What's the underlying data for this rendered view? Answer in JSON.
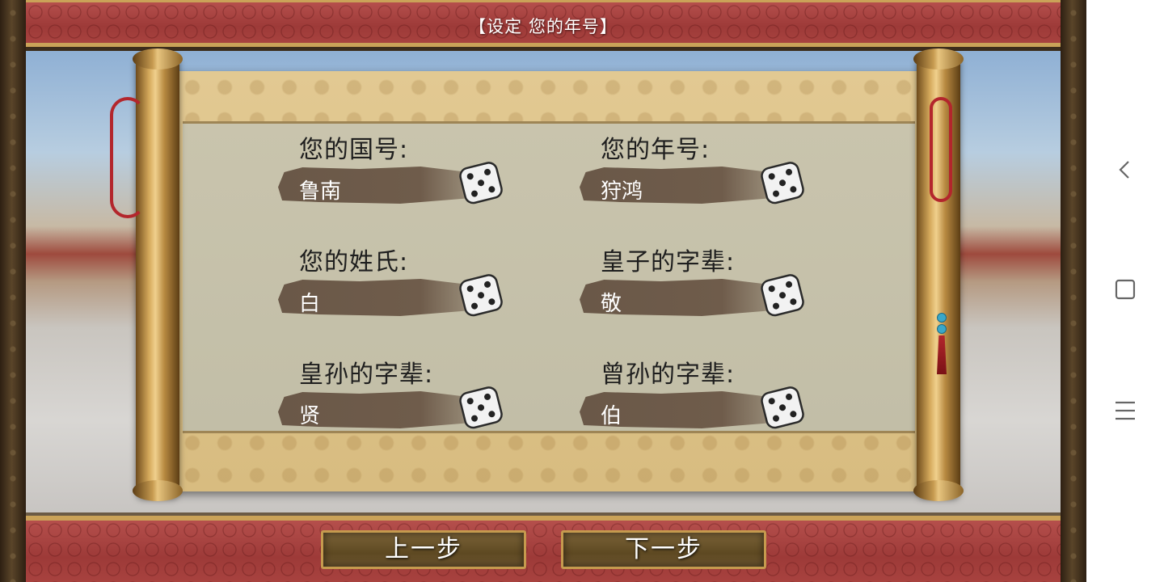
{
  "header": {
    "title": "【设定 您的年号】"
  },
  "fields": {
    "country": {
      "label": "您的国号:",
      "value": "鲁南"
    },
    "era": {
      "label": "您的年号:",
      "value": "狩鸿"
    },
    "surname": {
      "label": "您的姓氏:",
      "value": "白"
    },
    "prince_generation": {
      "label": "皇子的字辈:",
      "value": "敬"
    },
    "grandson_generation": {
      "label": "皇孙的字辈:",
      "value": "贤"
    },
    "great_grandson_generation": {
      "label": "曾孙的字辈:",
      "value": "伯"
    }
  },
  "buttons": {
    "prev": "上一步",
    "next": "下一步"
  },
  "icons": {
    "dice": "dice-icon",
    "back": "back-icon",
    "home": "home-icon",
    "menu": "menu-icon"
  }
}
